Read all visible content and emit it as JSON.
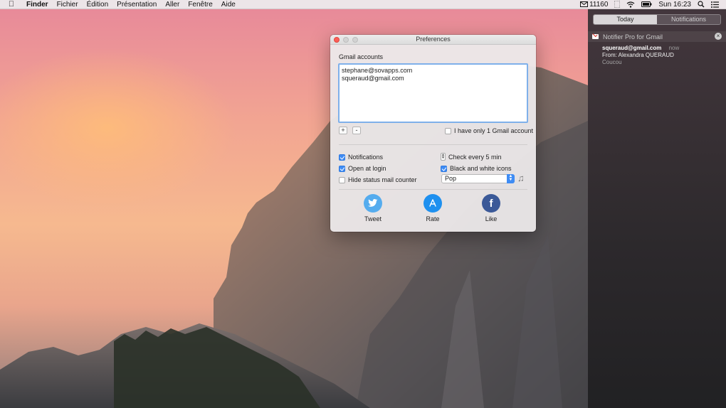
{
  "menubar": {
    "apple_icon": "apple-logo-icon",
    "items": [
      "Finder",
      "Fichier",
      "Édition",
      "Présentation",
      "Aller",
      "Fenêtre",
      "Aide"
    ],
    "mail_count": "11160",
    "clock": "Sun 16:23"
  },
  "prefs_window": {
    "title": "Preferences",
    "accounts_label": "Gmail accounts",
    "accounts": [
      "stephane@sovapps.com",
      "squeraud@gmail.com"
    ],
    "add_label": "+",
    "remove_label": "-",
    "single_account_label": "I have only 1 Gmail account",
    "single_account_checked": false,
    "notifications_label": "Notifications",
    "notifications_checked": true,
    "open_login_label": "Open at login",
    "open_login_checked": true,
    "hide_counter_label": "Hide status mail counter",
    "hide_counter_checked": false,
    "check_every_label": "Check every 5 min",
    "bw_icons_label": "Black and white icons",
    "bw_icons_checked": true,
    "sound_selected": "Pop",
    "share": {
      "tweet_label": "Tweet",
      "rate_label": "Rate",
      "like_label": "Like"
    },
    "colors": {
      "accent": "#3f8cf4",
      "twitter": "#55acee",
      "appstore": "#1e90ef",
      "facebook": "#3b5998"
    }
  },
  "notification_center": {
    "tab_today": "Today",
    "tab_notifications": "Notifications",
    "app_name": "Notifier Pro for Gmail",
    "notif_title": "squeraud@gmail.com",
    "notif_time": "now",
    "notif_from": "From: Alexandra QUERAUD",
    "notif_body": "Coucou"
  }
}
